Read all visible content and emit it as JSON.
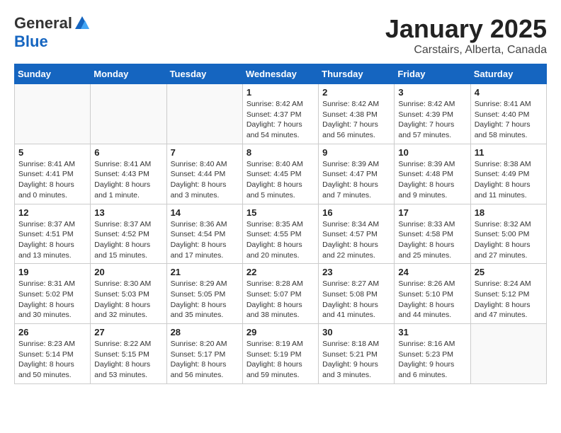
{
  "logo": {
    "general": "General",
    "blue": "Blue"
  },
  "title": "January 2025",
  "subtitle": "Carstairs, Alberta, Canada",
  "days_of_week": [
    "Sunday",
    "Monday",
    "Tuesday",
    "Wednesday",
    "Thursday",
    "Friday",
    "Saturday"
  ],
  "weeks": [
    [
      {
        "day": "",
        "info": ""
      },
      {
        "day": "",
        "info": ""
      },
      {
        "day": "",
        "info": ""
      },
      {
        "day": "1",
        "info": "Sunrise: 8:42 AM\nSunset: 4:37 PM\nDaylight: 7 hours and 54 minutes."
      },
      {
        "day": "2",
        "info": "Sunrise: 8:42 AM\nSunset: 4:38 PM\nDaylight: 7 hours and 56 minutes."
      },
      {
        "day": "3",
        "info": "Sunrise: 8:42 AM\nSunset: 4:39 PM\nDaylight: 7 hours and 57 minutes."
      },
      {
        "day": "4",
        "info": "Sunrise: 8:41 AM\nSunset: 4:40 PM\nDaylight: 7 hours and 58 minutes."
      }
    ],
    [
      {
        "day": "5",
        "info": "Sunrise: 8:41 AM\nSunset: 4:41 PM\nDaylight: 8 hours and 0 minutes."
      },
      {
        "day": "6",
        "info": "Sunrise: 8:41 AM\nSunset: 4:43 PM\nDaylight: 8 hours and 1 minute."
      },
      {
        "day": "7",
        "info": "Sunrise: 8:40 AM\nSunset: 4:44 PM\nDaylight: 8 hours and 3 minutes."
      },
      {
        "day": "8",
        "info": "Sunrise: 8:40 AM\nSunset: 4:45 PM\nDaylight: 8 hours and 5 minutes."
      },
      {
        "day": "9",
        "info": "Sunrise: 8:39 AM\nSunset: 4:47 PM\nDaylight: 8 hours and 7 minutes."
      },
      {
        "day": "10",
        "info": "Sunrise: 8:39 AM\nSunset: 4:48 PM\nDaylight: 8 hours and 9 minutes."
      },
      {
        "day": "11",
        "info": "Sunrise: 8:38 AM\nSunset: 4:49 PM\nDaylight: 8 hours and 11 minutes."
      }
    ],
    [
      {
        "day": "12",
        "info": "Sunrise: 8:37 AM\nSunset: 4:51 PM\nDaylight: 8 hours and 13 minutes."
      },
      {
        "day": "13",
        "info": "Sunrise: 8:37 AM\nSunset: 4:52 PM\nDaylight: 8 hours and 15 minutes."
      },
      {
        "day": "14",
        "info": "Sunrise: 8:36 AM\nSunset: 4:54 PM\nDaylight: 8 hours and 17 minutes."
      },
      {
        "day": "15",
        "info": "Sunrise: 8:35 AM\nSunset: 4:55 PM\nDaylight: 8 hours and 20 minutes."
      },
      {
        "day": "16",
        "info": "Sunrise: 8:34 AM\nSunset: 4:57 PM\nDaylight: 8 hours and 22 minutes."
      },
      {
        "day": "17",
        "info": "Sunrise: 8:33 AM\nSunset: 4:58 PM\nDaylight: 8 hours and 25 minutes."
      },
      {
        "day": "18",
        "info": "Sunrise: 8:32 AM\nSunset: 5:00 PM\nDaylight: 8 hours and 27 minutes."
      }
    ],
    [
      {
        "day": "19",
        "info": "Sunrise: 8:31 AM\nSunset: 5:02 PM\nDaylight: 8 hours and 30 minutes."
      },
      {
        "day": "20",
        "info": "Sunrise: 8:30 AM\nSunset: 5:03 PM\nDaylight: 8 hours and 32 minutes."
      },
      {
        "day": "21",
        "info": "Sunrise: 8:29 AM\nSunset: 5:05 PM\nDaylight: 8 hours and 35 minutes."
      },
      {
        "day": "22",
        "info": "Sunrise: 8:28 AM\nSunset: 5:07 PM\nDaylight: 8 hours and 38 minutes."
      },
      {
        "day": "23",
        "info": "Sunrise: 8:27 AM\nSunset: 5:08 PM\nDaylight: 8 hours and 41 minutes."
      },
      {
        "day": "24",
        "info": "Sunrise: 8:26 AM\nSunset: 5:10 PM\nDaylight: 8 hours and 44 minutes."
      },
      {
        "day": "25",
        "info": "Sunrise: 8:24 AM\nSunset: 5:12 PM\nDaylight: 8 hours and 47 minutes."
      }
    ],
    [
      {
        "day": "26",
        "info": "Sunrise: 8:23 AM\nSunset: 5:14 PM\nDaylight: 8 hours and 50 minutes."
      },
      {
        "day": "27",
        "info": "Sunrise: 8:22 AM\nSunset: 5:15 PM\nDaylight: 8 hours and 53 minutes."
      },
      {
        "day": "28",
        "info": "Sunrise: 8:20 AM\nSunset: 5:17 PM\nDaylight: 8 hours and 56 minutes."
      },
      {
        "day": "29",
        "info": "Sunrise: 8:19 AM\nSunset: 5:19 PM\nDaylight: 8 hours and 59 minutes."
      },
      {
        "day": "30",
        "info": "Sunrise: 8:18 AM\nSunset: 5:21 PM\nDaylight: 9 hours and 3 minutes."
      },
      {
        "day": "31",
        "info": "Sunrise: 8:16 AM\nSunset: 5:23 PM\nDaylight: 9 hours and 6 minutes."
      },
      {
        "day": "",
        "info": ""
      }
    ]
  ]
}
